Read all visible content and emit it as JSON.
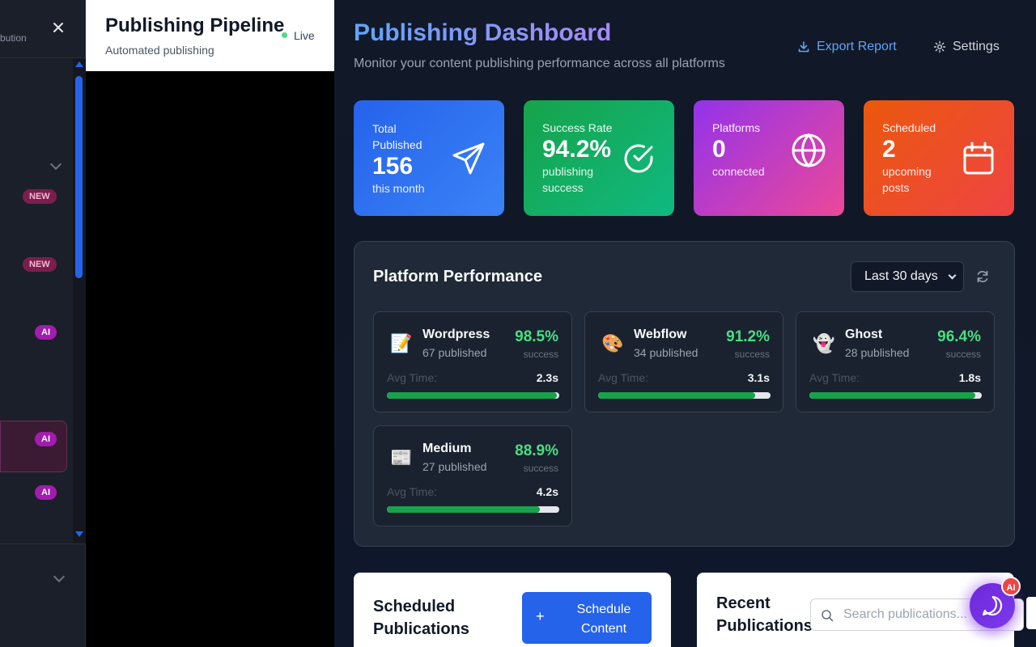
{
  "sidebar": {
    "header_text": "bution",
    "badges": [
      "NEW",
      "NEW",
      "AI",
      "AI",
      "AI"
    ]
  },
  "pipeline": {
    "title": "Publishing Pipeline",
    "subtitle": "Automated publishing",
    "status": "Live"
  },
  "header": {
    "title": "Publishing Dashboard",
    "subtitle": "Monitor your content publishing performance across all platforms",
    "export_label": "Export Report",
    "settings_label": "Settings"
  },
  "stats": [
    {
      "label": "Total Published",
      "value": "156",
      "sub": "this month",
      "icon": "send-icon"
    },
    {
      "label": "Success Rate",
      "value": "94.2%",
      "sub": "publishing success",
      "icon": "check-circle-icon"
    },
    {
      "label": "Platforms",
      "value": "0",
      "sub": "connected",
      "icon": "globe-icon"
    },
    {
      "label": "Scheduled",
      "value": "2",
      "sub": "upcoming posts",
      "icon": "calendar-icon"
    }
  ],
  "colors": {
    "stat_total": "#2563eb",
    "stat_success": "#16a34a",
    "stat_platforms": "#c026d3",
    "stat_scheduled": "#ef4444",
    "success_green": "#4ade80",
    "accent_blue": "#60a5fa"
  },
  "performance": {
    "title": "Platform Performance",
    "range": "Last 30 days",
    "avg_label": "Avg Time:",
    "success_label": "success",
    "platforms": [
      {
        "name": "Wordpress",
        "count": "67 published",
        "rate": "98.5%",
        "avg": "2.3s",
        "progress": 0.985,
        "icon": "memo-icon",
        "glyph": "📝"
      },
      {
        "name": "Webflow",
        "count": "34 published",
        "rate": "91.2%",
        "avg": "3.1s",
        "progress": 0.912,
        "icon": "palette-icon",
        "glyph": "🎨"
      },
      {
        "name": "Ghost",
        "count": "28 published",
        "rate": "96.4%",
        "avg": "1.8s",
        "progress": 0.964,
        "icon": "ghost-icon",
        "glyph": "👻"
      },
      {
        "name": "Medium",
        "count": "27 published",
        "rate": "88.9%",
        "avg": "4.2s",
        "progress": 0.889,
        "icon": "newspaper-icon",
        "glyph": "📰"
      }
    ]
  },
  "scheduled": {
    "title_line1": "Scheduled",
    "title_line2": "Publications",
    "button_line1": "Schedule",
    "button_line2": "Content"
  },
  "recent": {
    "title_line1": "Recent",
    "title_line2": "Publications",
    "search_placeholder": "Search publications..."
  },
  "chat": {
    "badge": "AI"
  }
}
